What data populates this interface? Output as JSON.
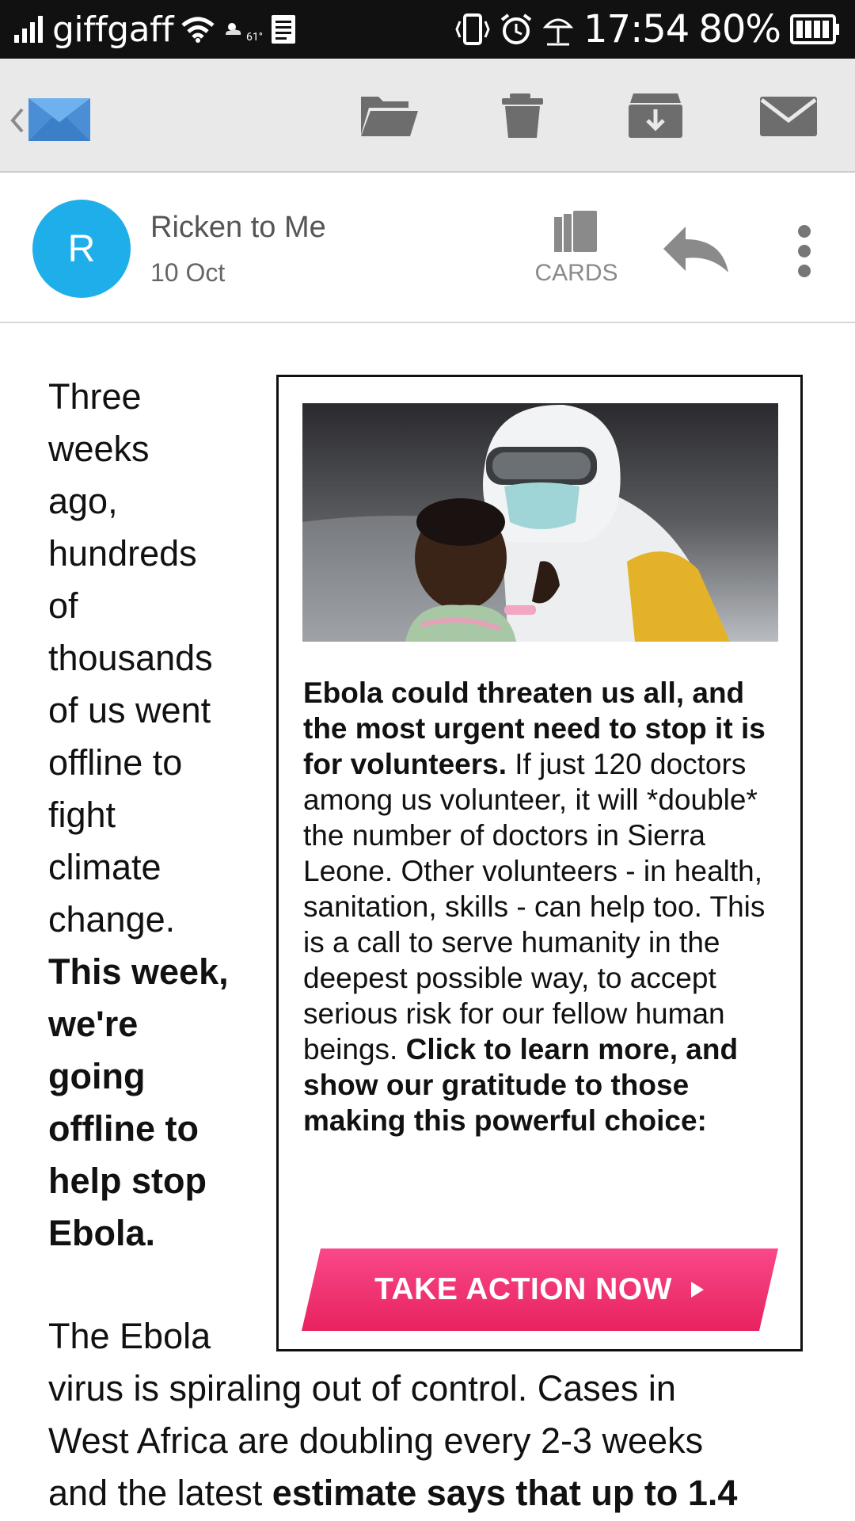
{
  "status_bar": {
    "carrier": "giffgaff",
    "temperature": "61°",
    "time": "17:54",
    "battery": "80%",
    "icons": [
      "signal-icon",
      "wifi-icon",
      "weather-icon",
      "notes-icon",
      "vibrate-icon",
      "alarm-icon",
      "beach-icon",
      "battery-icon"
    ]
  },
  "toolbar": {
    "icons": [
      "back-chevron-icon",
      "mail-app-icon",
      "folder-icon",
      "trash-icon",
      "archive-icon",
      "envelope-icon"
    ]
  },
  "header": {
    "avatar_letter": "R",
    "sender_line": "Ricken to Me",
    "date": "10 Oct",
    "cards_label": "CARDS",
    "avatar_color": "#1eaee9"
  },
  "body": {
    "intro_lines": [
      "Three",
      "weeks",
      "ago,",
      "hundreds",
      "of",
      "thousands",
      "of us went",
      "offline to",
      "fight",
      "climate",
      "change."
    ],
    "bold_lines": [
      "This week,",
      "we're",
      "going",
      "offline to",
      "help stop",
      "Ebola."
    ],
    "section2_first": "The Ebola",
    "section2_line2": "virus is spiraling out of control. Cases in",
    "section2_line3": "West Africa are doubling every 2-3 weeks",
    "section2_line4_plain": "and the latest ",
    "section2_line4_bold": "estimate says that up to 1.4"
  },
  "card": {
    "text_bold_1": "Ebola could threaten us all, and the most urgent need to stop it is for volunteers.",
    "text_plain": " If just 120 doctors among us volunteer, it will *double* the number of doctors in Sierra Leone. Other volunteers - in health, sanitation, skills - can help too. This is a call to serve humanity in the deepest possible way, to accept serious risk for our fellow human beings. ",
    "text_bold_2": "Click to learn more, and show our gratitude to those making this powerful choice:",
    "cta_label": "TAKE ACTION NOW",
    "cta_color": "#f0346f"
  }
}
